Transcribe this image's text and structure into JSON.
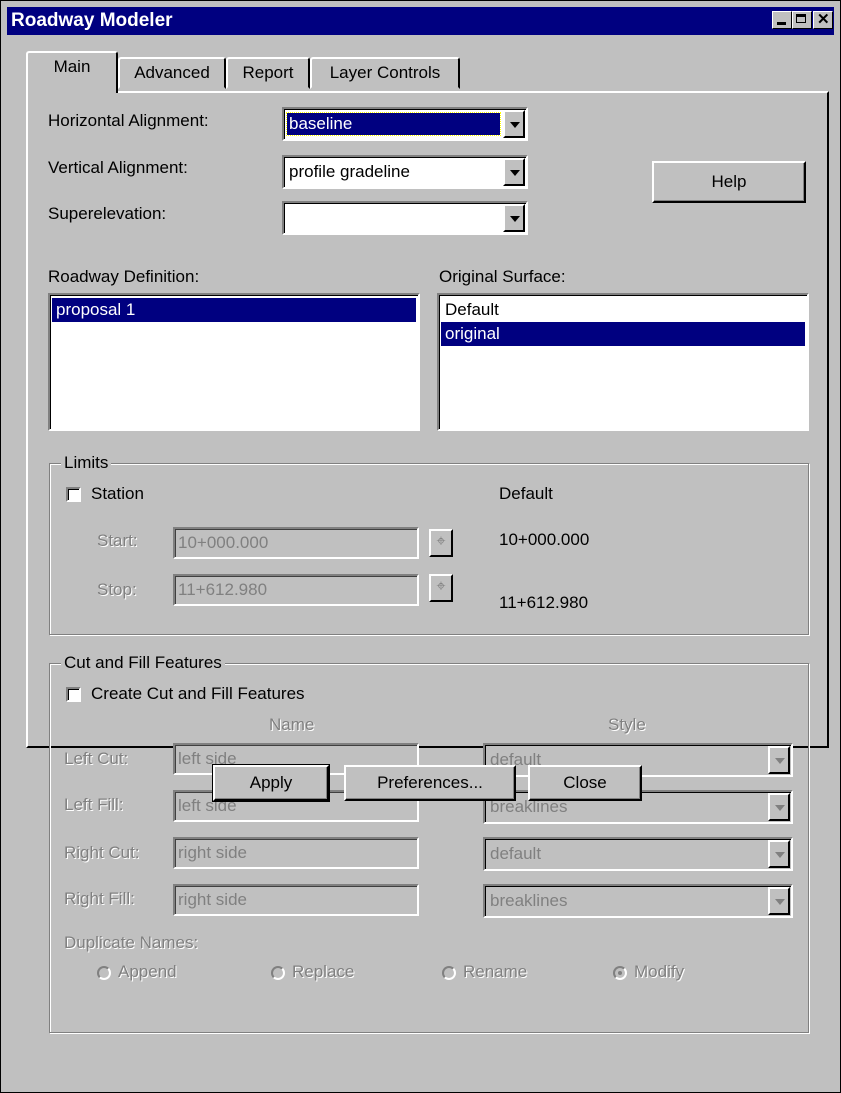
{
  "window": {
    "title": "Roadway Modeler"
  },
  "tabs": [
    "Main",
    "Advanced",
    "Report",
    "Layer Controls"
  ],
  "alignment": {
    "horizontal_label": "Horizontal Alignment:",
    "horizontal_value": "baseline",
    "vertical_label": "Vertical Alignment:",
    "vertical_value": "profile gradeline",
    "super_label": "Superelevation:",
    "super_value": ""
  },
  "help_label": "Help",
  "roadway": {
    "label": "Roadway Definition:",
    "items": [
      "proposal 1"
    ]
  },
  "surface": {
    "label": "Original Surface:",
    "items": [
      "Default",
      "original"
    ]
  },
  "limits": {
    "title": "Limits",
    "station_label": "Station",
    "default_header": "Default",
    "start_label": "Start:",
    "start_value": "10+000.000",
    "start_default": "10+000.000",
    "stop_label": "Stop:",
    "stop_value": "11+612.980",
    "stop_default": "11+612.980"
  },
  "cutfill": {
    "title": "Cut and Fill Features",
    "create_label": "Create Cut and Fill Features",
    "name_header": "Name",
    "style_header": "Style",
    "rows": [
      {
        "label": "Left Cut:",
        "name": "left side",
        "style": "default"
      },
      {
        "label": "Left Fill:",
        "name": "left side",
        "style": "breaklines"
      },
      {
        "label": "Right Cut:",
        "name": "right side",
        "style": "default"
      },
      {
        "label": "Right Fill:",
        "name": "right side",
        "style": "breaklines"
      }
    ],
    "dup_label": "Duplicate Names:",
    "options": [
      "Append",
      "Replace",
      "Rename",
      "Modify"
    ],
    "selected_option": "Modify"
  },
  "buttons": {
    "apply": "Apply",
    "preferences": "Preferences...",
    "close": "Close"
  },
  "colors": {
    "titlebar": "#000080",
    "selection": "#000080",
    "face": "#c0c0c0",
    "disabled_text": "#808080"
  }
}
